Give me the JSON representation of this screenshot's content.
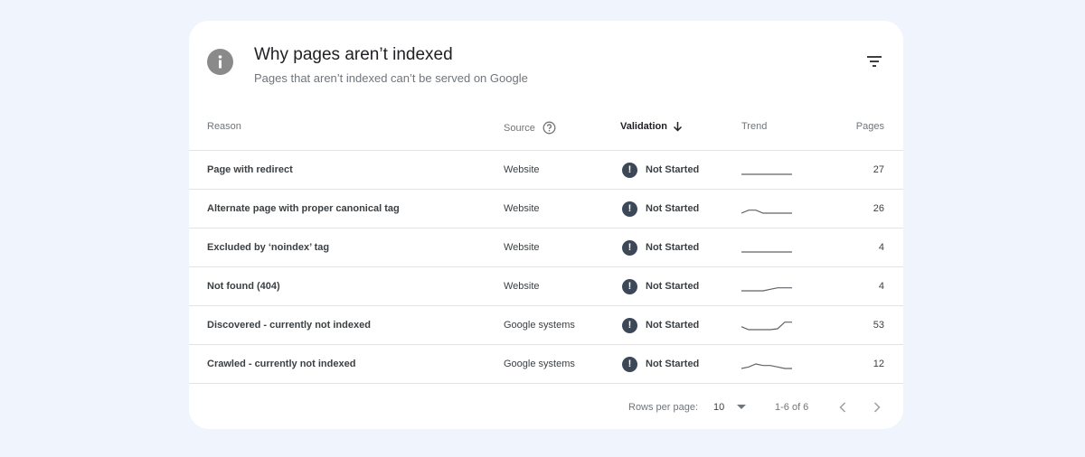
{
  "header": {
    "title": "Why pages aren’t indexed",
    "subtitle": "Pages that aren’t indexed can’t be served on Google",
    "info_icon": "info-icon",
    "filter_icon": "filter-icon"
  },
  "table": {
    "columns": {
      "reason": "Reason",
      "source": "Source",
      "validation": "Validation",
      "trend": "Trend",
      "pages": "Pages"
    },
    "rows": [
      {
        "reason": "Page with redirect",
        "source": "Website",
        "validation": "Not Started",
        "pages": "27",
        "trend": [
          0,
          0,
          0,
          0,
          0,
          0,
          0,
          0
        ]
      },
      {
        "reason": "Alternate page with proper canonical tag",
        "source": "Website",
        "validation": "Not Started",
        "pages": "26",
        "trend": [
          0,
          1,
          1,
          0,
          0,
          0,
          0,
          0
        ]
      },
      {
        "reason": "Excluded by ‘noindex’ tag",
        "source": "Website",
        "validation": "Not Started",
        "pages": "4",
        "trend": [
          0,
          0,
          0,
          0,
          0,
          0,
          0,
          0
        ]
      },
      {
        "reason": "Not found (404)",
        "source": "Website",
        "validation": "Not Started",
        "pages": "4",
        "trend": [
          0,
          0,
          0,
          0,
          0.5,
          1,
          1,
          1
        ]
      },
      {
        "reason": "Discovered - currently not indexed",
        "source": "Google systems",
        "validation": "Not Started",
        "pages": "53",
        "trend": [
          1,
          0,
          0,
          0,
          0,
          0.3,
          2.5,
          2.5
        ]
      },
      {
        "reason": "Crawled - currently not indexed",
        "source": "Google systems",
        "validation": "Not Started",
        "pages": "12",
        "trend": [
          0,
          0.5,
          1.5,
          1,
          1,
          0.5,
          0,
          0
        ]
      }
    ]
  },
  "footer": {
    "rows_per_page_label": "Rows per page:",
    "rows_per_page_value": "10",
    "range": "1-6 of 6"
  },
  "colors": {
    "background": "#f0f4fc",
    "card": "#ffffff",
    "status_badge": "#3c4858"
  }
}
